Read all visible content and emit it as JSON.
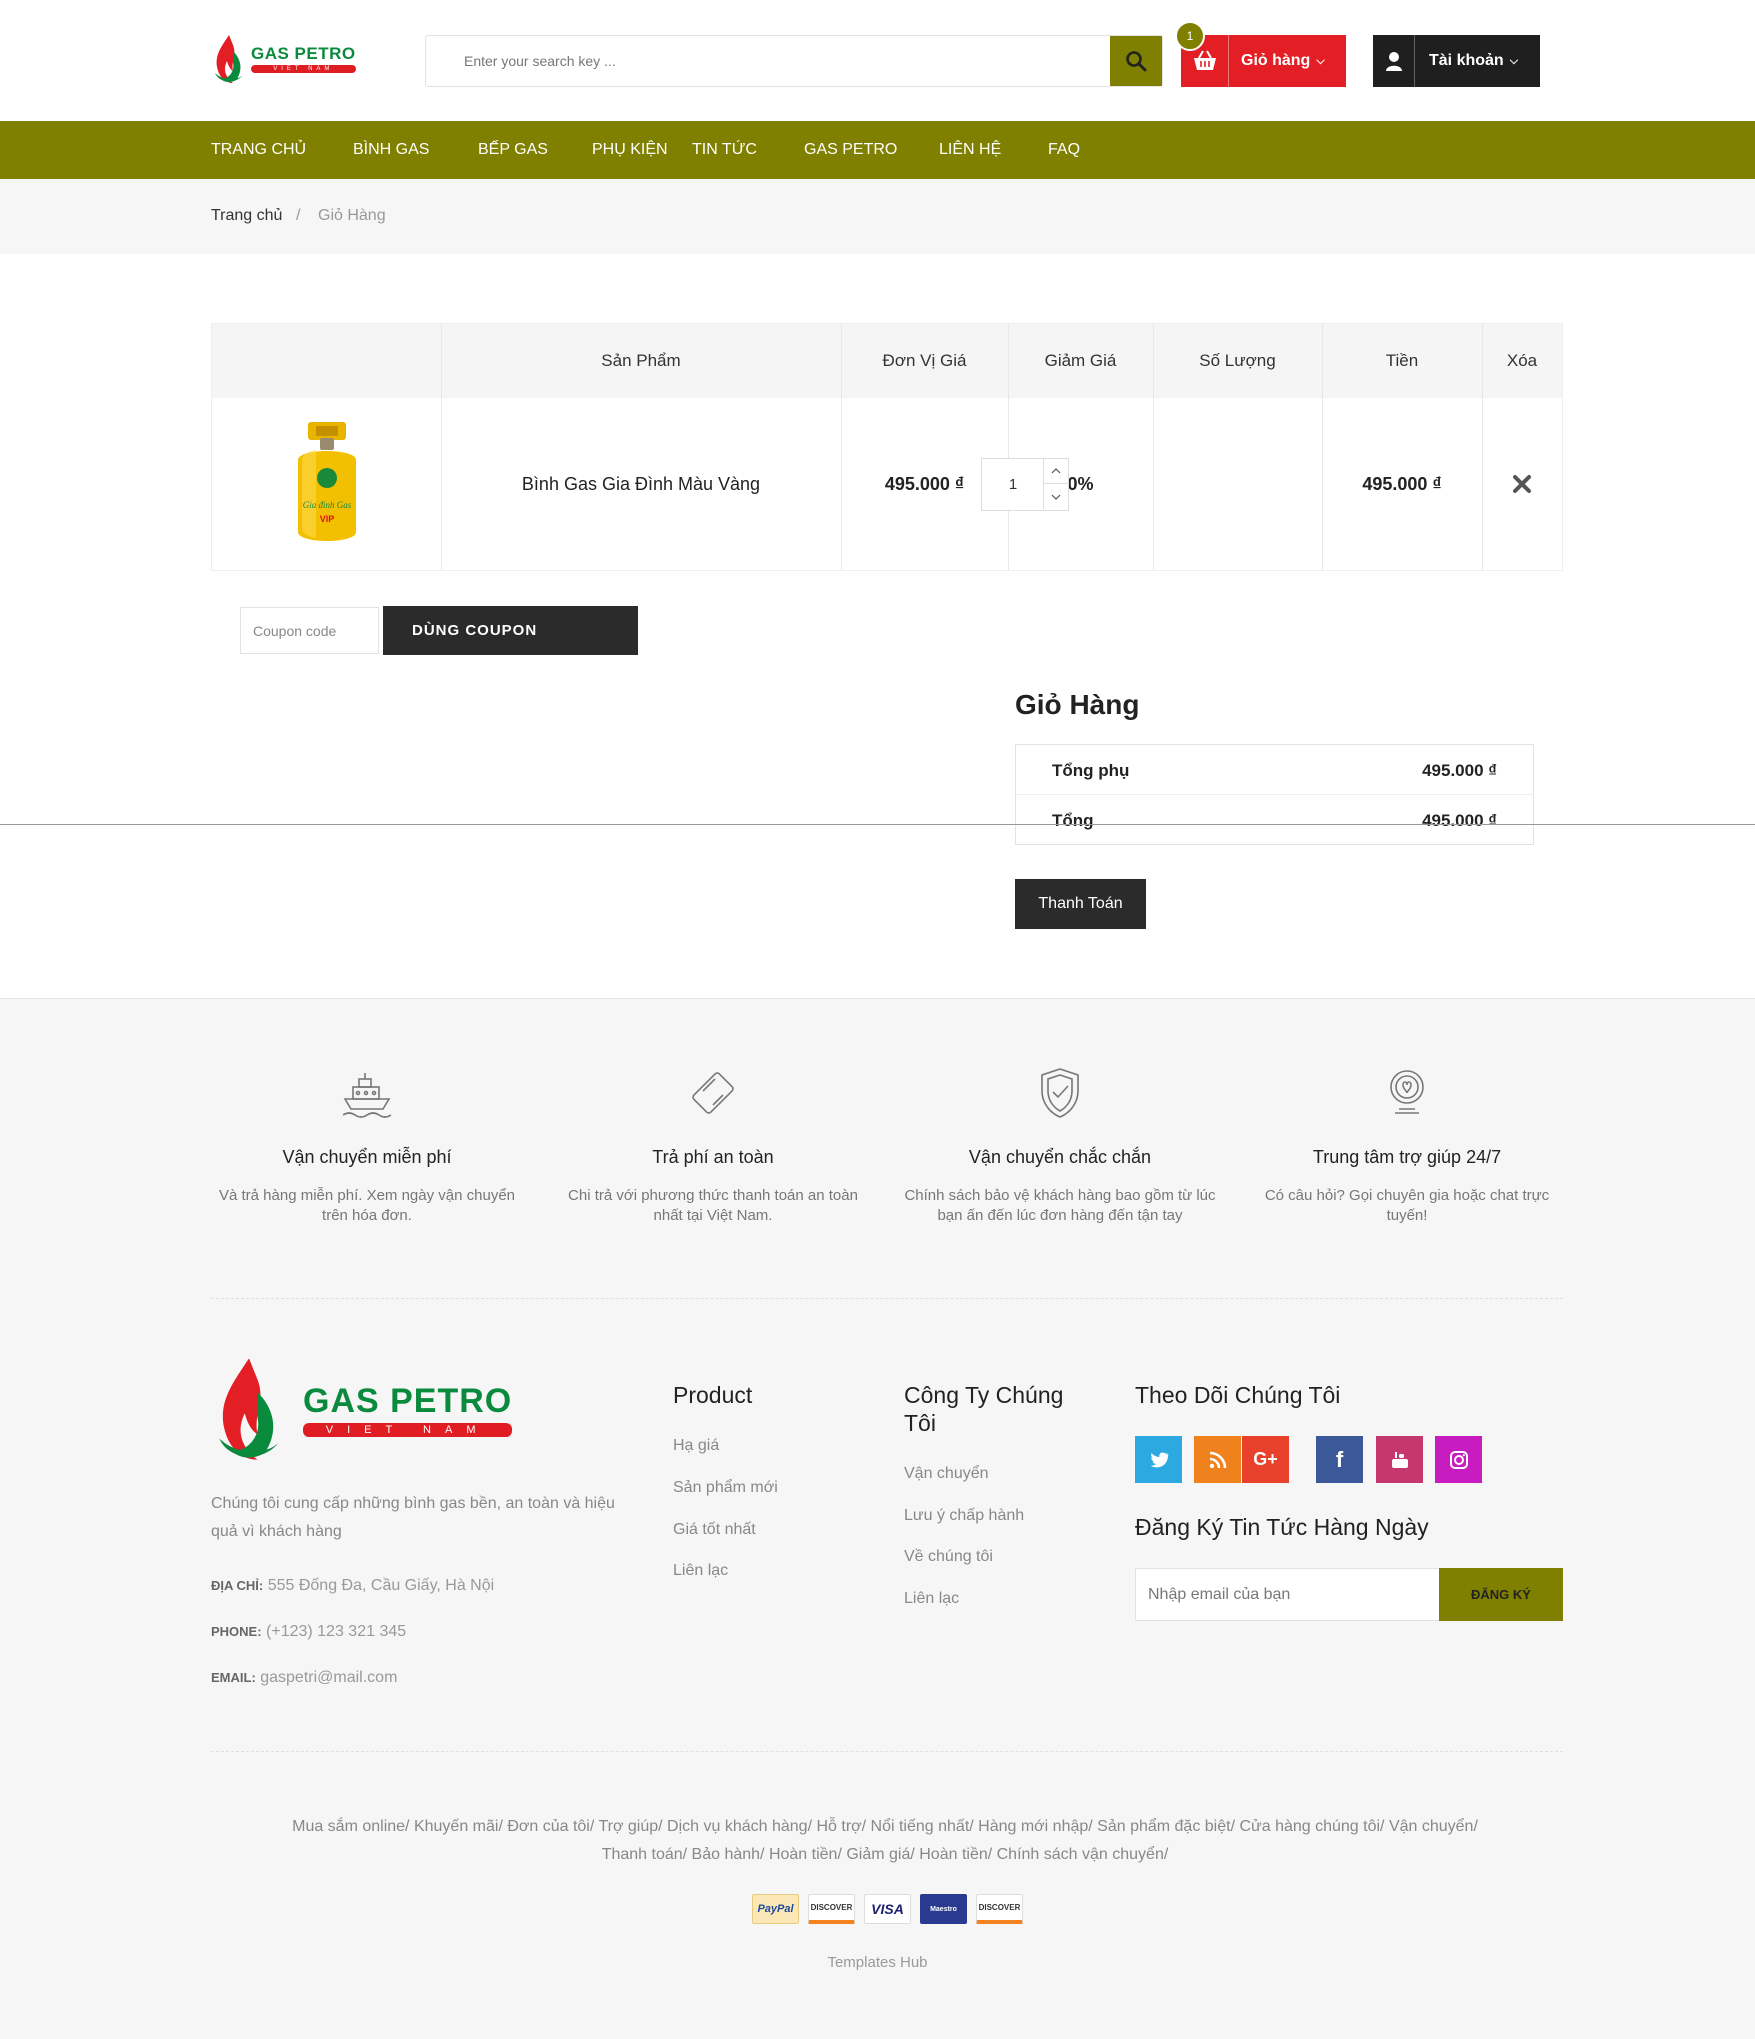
{
  "header": {
    "logo_brand": "GAS PETRO",
    "logo_sub": "VIET NAM",
    "search_placeholder": "Enter your search key ...",
    "cart_count": "1",
    "cart_label": "Giỏ hàng",
    "account_label": "Tài khoản"
  },
  "nav": [
    "TRANG CHỦ",
    "BÌNH GAS",
    "BẾP GAS",
    "PHỤ KIỆN",
    "TIN TỨC",
    "GAS PETRO",
    "LIÊN HỆ",
    "FAQ"
  ],
  "breadcrumb": {
    "home": "Trang chủ",
    "separator": "/",
    "current": "Giỏ Hàng"
  },
  "cart_table": {
    "headers": [
      "Sản Phẩm",
      "Đơn Vị Giá",
      "Giảm Giá",
      "Số Lượng",
      "Tiền",
      "Xóa"
    ],
    "rows": [
      {
        "product": "Bình Gas Gia Đình Màu Vàng",
        "unit_price": "495.000 ₫",
        "discount": "0%",
        "quantity": "1",
        "total": "495.000 ₫"
      }
    ]
  },
  "coupon": {
    "placeholder": "Coupon code",
    "button": "DÙNG COUPON"
  },
  "totals": {
    "title": "Giỏ Hàng",
    "subtotal_label": "Tổng phụ",
    "subtotal_value": "495.000 ₫",
    "total_label": "Tổng",
    "total_value": "495.000 ₫",
    "checkout": "Thanh Toán"
  },
  "features": [
    {
      "icon": "ship-icon",
      "title": "Vận chuyển miễn phí",
      "desc": "Và trả hàng miễn phí. Xem ngày vận chuyển trên hóa đơn."
    },
    {
      "icon": "payment-card-icon",
      "title": "Trả phí an toàn",
      "desc": "Chi trả với phương thức thanh toán an toàn nhất tại Việt Nam."
    },
    {
      "icon": "shield-check-icon",
      "title": "Vận chuyển chắc chắn",
      "desc": "Chính sách bảo vệ khách hàng bao gồm từ lúc bạn ấn đến lúc đơn hàng đến tận tay"
    },
    {
      "icon": "support-icon",
      "title": "Trung tâm trợ giúp 24/7",
      "desc": "Có câu hỏi? Gọi chuyên gia hoặc chat trực tuyến!"
    }
  ],
  "footer": {
    "about": "Chúng tôi cung cấp những bình gas bền, an toàn và hiệu quả vì khách hàng",
    "address_label": "ĐỊA CHỈ:",
    "address": "555 Đống Đa, Cầu Giấy, Hà Nội",
    "phone_label": "PHONE:",
    "phone": "(+123) 123 321 345",
    "email_label": "EMAIL:",
    "email": "gaspetri@mail.com",
    "product_title": "Product",
    "product_links": [
      "Hạ giá",
      "Sản phẩm mới",
      "Giá tốt nhất",
      "Liên lạc"
    ],
    "company_title": "Công Ty Chúng Tôi",
    "company_links": [
      "Vận chuyển",
      "Lưu ý chấp hành",
      "Về chúng tôi",
      "Liên lạc"
    ],
    "follow_title": "Theo Dõi Chúng Tôi",
    "social": [
      "twitter-icon",
      "rss-icon",
      "google-plus-icon",
      "facebook-icon",
      "youtube-icon",
      "instagram-icon"
    ],
    "newsletter_title": "Đăng Ký Tin Tức Hàng Ngày",
    "newsletter_placeholder": "Nhập email của bạn",
    "newsletter_button": "ĐĂNG KÝ",
    "bottom_links_1": "Mua sắm online/ Khuyến mãi/ Đơn của tôi/ Trợ giúp/ Dịch vụ khách hàng/ Hỗ trợ/ Nổi tiếng nhất/ Hàng mới nhập/ Sản phẩm đặc biệt/ Cửa hàng chúng tôi/ Vận chuyển/",
    "bottom_links_2": "Thanh toán/ Bảo hành/ Hoàn tiền/ Giảm giá/ Hoàn tiền/ Chính sách vận chuyển/",
    "payments": [
      "PayPal",
      "DISCOVER",
      "VISA",
      "Maestro",
      "DISCOVER"
    ],
    "credit": "Templates Hub"
  },
  "colors": {
    "olive": "#7f8000",
    "red": "#e31e24",
    "dark": "#2b2b2b"
  }
}
